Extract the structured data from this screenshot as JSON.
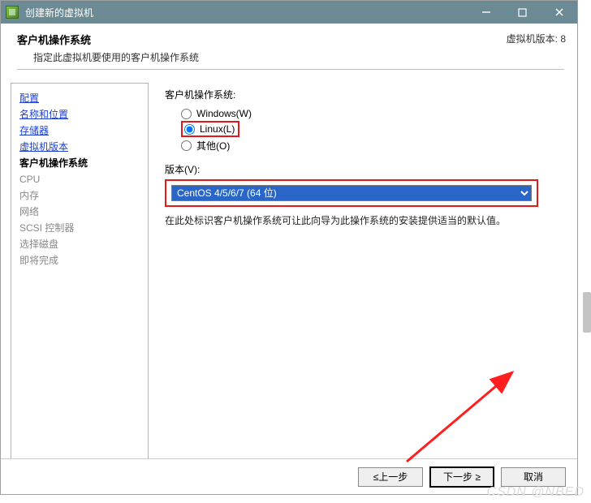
{
  "titlebar": {
    "title": "创建新的虚拟机"
  },
  "header": {
    "title": "客户机操作系统",
    "subtitle": "指定此虚拟机要使用的客户机操作系统",
    "right_info": "虚拟机版本: 8"
  },
  "sidebar": {
    "items": [
      {
        "label": "配置",
        "kind": "link"
      },
      {
        "label": "名称和位置",
        "kind": "link"
      },
      {
        "label": "存储器",
        "kind": "link"
      },
      {
        "label": "虚拟机版本",
        "kind": "link"
      },
      {
        "label": "客户机操作系统",
        "kind": "current"
      },
      {
        "label": "CPU",
        "kind": "disabled"
      },
      {
        "label": "内存",
        "kind": "disabled"
      },
      {
        "label": "网络",
        "kind": "disabled"
      },
      {
        "label": "SCSI 控制器",
        "kind": "disabled"
      },
      {
        "label": "选择磁盘",
        "kind": "disabled"
      },
      {
        "label": "即将完成",
        "kind": "disabled"
      }
    ]
  },
  "main": {
    "os_group_label": "客户机操作系统:",
    "radios": [
      {
        "label": "Windows(W)",
        "checked": false
      },
      {
        "label": "Linux(L)",
        "checked": true
      },
      {
        "label": "其他(O)",
        "checked": false
      }
    ],
    "version_label": "版本(V):",
    "version_value": "CentOS 4/5/6/7 (64 位)",
    "hint": "在此处标识客户机操作系统可让此向导为此操作系统的安装提供适当的默认值。"
  },
  "footer": {
    "back": "≤上一步",
    "next": "下一步 ≥",
    "cancel": "取消"
  },
  "watermark": "CSDN @NBED"
}
